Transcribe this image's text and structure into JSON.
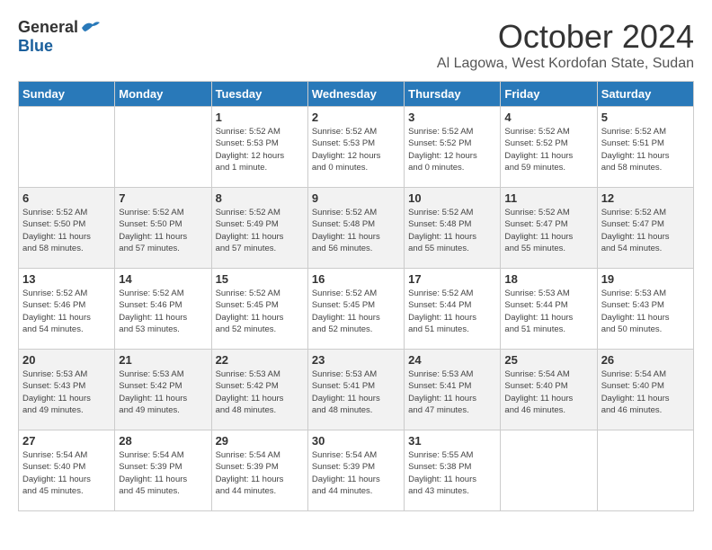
{
  "logo": {
    "general": "General",
    "blue": "Blue"
  },
  "title": "October 2024",
  "location": "Al Lagowa, West Kordofan State, Sudan",
  "headers": [
    "Sunday",
    "Monday",
    "Tuesday",
    "Wednesday",
    "Thursday",
    "Friday",
    "Saturday"
  ],
  "weeks": [
    [
      {
        "day": "",
        "info": ""
      },
      {
        "day": "",
        "info": ""
      },
      {
        "day": "1",
        "info": "Sunrise: 5:52 AM\nSunset: 5:53 PM\nDaylight: 12 hours\nand 1 minute."
      },
      {
        "day": "2",
        "info": "Sunrise: 5:52 AM\nSunset: 5:53 PM\nDaylight: 12 hours\nand 0 minutes."
      },
      {
        "day": "3",
        "info": "Sunrise: 5:52 AM\nSunset: 5:52 PM\nDaylight: 12 hours\nand 0 minutes."
      },
      {
        "day": "4",
        "info": "Sunrise: 5:52 AM\nSunset: 5:52 PM\nDaylight: 11 hours\nand 59 minutes."
      },
      {
        "day": "5",
        "info": "Sunrise: 5:52 AM\nSunset: 5:51 PM\nDaylight: 11 hours\nand 58 minutes."
      }
    ],
    [
      {
        "day": "6",
        "info": "Sunrise: 5:52 AM\nSunset: 5:50 PM\nDaylight: 11 hours\nand 58 minutes."
      },
      {
        "day": "7",
        "info": "Sunrise: 5:52 AM\nSunset: 5:50 PM\nDaylight: 11 hours\nand 57 minutes."
      },
      {
        "day": "8",
        "info": "Sunrise: 5:52 AM\nSunset: 5:49 PM\nDaylight: 11 hours\nand 57 minutes."
      },
      {
        "day": "9",
        "info": "Sunrise: 5:52 AM\nSunset: 5:48 PM\nDaylight: 11 hours\nand 56 minutes."
      },
      {
        "day": "10",
        "info": "Sunrise: 5:52 AM\nSunset: 5:48 PM\nDaylight: 11 hours\nand 55 minutes."
      },
      {
        "day": "11",
        "info": "Sunrise: 5:52 AM\nSunset: 5:47 PM\nDaylight: 11 hours\nand 55 minutes."
      },
      {
        "day": "12",
        "info": "Sunrise: 5:52 AM\nSunset: 5:47 PM\nDaylight: 11 hours\nand 54 minutes."
      }
    ],
    [
      {
        "day": "13",
        "info": "Sunrise: 5:52 AM\nSunset: 5:46 PM\nDaylight: 11 hours\nand 54 minutes."
      },
      {
        "day": "14",
        "info": "Sunrise: 5:52 AM\nSunset: 5:46 PM\nDaylight: 11 hours\nand 53 minutes."
      },
      {
        "day": "15",
        "info": "Sunrise: 5:52 AM\nSunset: 5:45 PM\nDaylight: 11 hours\nand 52 minutes."
      },
      {
        "day": "16",
        "info": "Sunrise: 5:52 AM\nSunset: 5:45 PM\nDaylight: 11 hours\nand 52 minutes."
      },
      {
        "day": "17",
        "info": "Sunrise: 5:52 AM\nSunset: 5:44 PM\nDaylight: 11 hours\nand 51 minutes."
      },
      {
        "day": "18",
        "info": "Sunrise: 5:53 AM\nSunset: 5:44 PM\nDaylight: 11 hours\nand 51 minutes."
      },
      {
        "day": "19",
        "info": "Sunrise: 5:53 AM\nSunset: 5:43 PM\nDaylight: 11 hours\nand 50 minutes."
      }
    ],
    [
      {
        "day": "20",
        "info": "Sunrise: 5:53 AM\nSunset: 5:43 PM\nDaylight: 11 hours\nand 49 minutes."
      },
      {
        "day": "21",
        "info": "Sunrise: 5:53 AM\nSunset: 5:42 PM\nDaylight: 11 hours\nand 49 minutes."
      },
      {
        "day": "22",
        "info": "Sunrise: 5:53 AM\nSunset: 5:42 PM\nDaylight: 11 hours\nand 48 minutes."
      },
      {
        "day": "23",
        "info": "Sunrise: 5:53 AM\nSunset: 5:41 PM\nDaylight: 11 hours\nand 48 minutes."
      },
      {
        "day": "24",
        "info": "Sunrise: 5:53 AM\nSunset: 5:41 PM\nDaylight: 11 hours\nand 47 minutes."
      },
      {
        "day": "25",
        "info": "Sunrise: 5:54 AM\nSunset: 5:40 PM\nDaylight: 11 hours\nand 46 minutes."
      },
      {
        "day": "26",
        "info": "Sunrise: 5:54 AM\nSunset: 5:40 PM\nDaylight: 11 hours\nand 46 minutes."
      }
    ],
    [
      {
        "day": "27",
        "info": "Sunrise: 5:54 AM\nSunset: 5:40 PM\nDaylight: 11 hours\nand 45 minutes."
      },
      {
        "day": "28",
        "info": "Sunrise: 5:54 AM\nSunset: 5:39 PM\nDaylight: 11 hours\nand 45 minutes."
      },
      {
        "day": "29",
        "info": "Sunrise: 5:54 AM\nSunset: 5:39 PM\nDaylight: 11 hours\nand 44 minutes."
      },
      {
        "day": "30",
        "info": "Sunrise: 5:54 AM\nSunset: 5:39 PM\nDaylight: 11 hours\nand 44 minutes."
      },
      {
        "day": "31",
        "info": "Sunrise: 5:55 AM\nSunset: 5:38 PM\nDaylight: 11 hours\nand 43 minutes."
      },
      {
        "day": "",
        "info": ""
      },
      {
        "day": "",
        "info": ""
      }
    ]
  ]
}
